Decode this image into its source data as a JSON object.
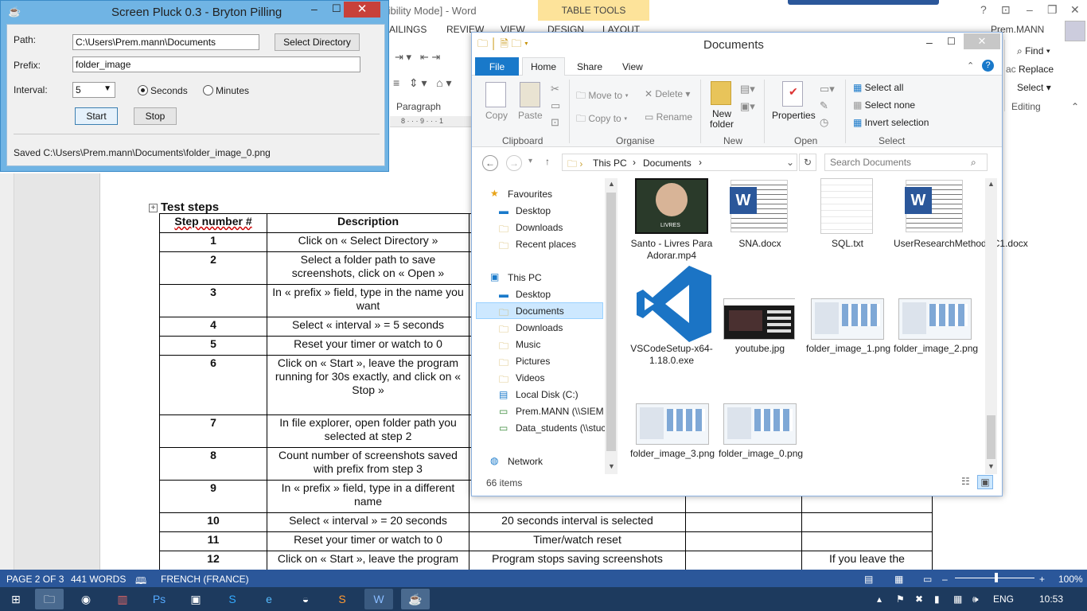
{
  "word": {
    "title": "tibility Mode] - Word",
    "table_tools": "TABLE TOOLS",
    "tabs": [
      "AILINGS",
      "REVIEW",
      "VIEW",
      "DESIGN",
      "LAYOUT"
    ],
    "user": "Prem.MANN",
    "paragraph_label": "Paragraph",
    "editing": {
      "find": "Find",
      "replace": "Replace",
      "select": "Select",
      "group": "Editing"
    },
    "heading": "Test steps",
    "table": {
      "headers": [
        "Step number #",
        "Description"
      ],
      "rows": [
        {
          "num": "1",
          "desc": "Click on « Select Directory »",
          "res": "",
          "c5": ""
        },
        {
          "num": "2",
          "desc": "Select a folder path to save screenshots, click on « Open »",
          "res": "",
          "c5": ""
        },
        {
          "num": "3",
          "desc": "In « prefix » field, type in the name you want",
          "res": "",
          "c5": ""
        },
        {
          "num": "4",
          "desc": "Select « interval » = 5 seconds",
          "res": "",
          "c5": ""
        },
        {
          "num": "5",
          "desc": "Reset your timer or watch to 0",
          "res": "",
          "c5": ""
        },
        {
          "num": "6",
          "desc": "Click on « Start », leave the program running for 30s exactly, and click on « Stop »",
          "res": "",
          "c5": ""
        },
        {
          "num": "7",
          "desc": "In file explorer, open folder path you selected at step 2",
          "res": "",
          "c5": ""
        },
        {
          "num": "8",
          "desc": "Count number of screenshots saved with prefix from step 3",
          "res": "",
          "c5": ""
        },
        {
          "num": "9",
          "desc": "In « prefix » field, type in a different name",
          "res": "",
          "c5": ""
        },
        {
          "num": "10",
          "desc": "Select « interval » = 20 seconds",
          "res": "20 seconds interval is selected",
          "c5": ""
        },
        {
          "num": "11",
          "desc": "Reset your timer or watch to 0",
          "res": "Timer/watch reset",
          "c5": ""
        },
        {
          "num": "12",
          "desc": "Click on « Start », leave the program",
          "res": "Program stops saving screenshots",
          "c5": "If you leave the"
        }
      ]
    },
    "status": {
      "page": "PAGE 2 OF 3",
      "words": "441 WORDS",
      "lang": "FRENCH (FRANCE)",
      "zoom": "100%"
    }
  },
  "screen_pluck": {
    "title": "Screen Pluck 0.3 - Bryton Pilling",
    "path_label": "Path:",
    "path_value": "C:\\Users\\Prem.mann\\Documents",
    "select_dir": "Select Directory",
    "prefix_label": "Prefix:",
    "prefix_value": "folder_image",
    "interval_label": "Interval:",
    "interval_value": "5",
    "seconds": "Seconds",
    "minutes": "Minutes",
    "start": "Start",
    "stop": "Stop",
    "saved": "Saved C:\\Users\\Prem.mann\\Documents\\folder_image_0.png"
  },
  "explorer": {
    "title": "Documents",
    "tabs": {
      "file": "File",
      "home": "Home",
      "share": "Share",
      "view": "View"
    },
    "ribbon": {
      "copy": "Copy",
      "paste": "Paste",
      "clipboard": "Clipboard",
      "move_to": "Move to",
      "copy_to": "Copy to",
      "delete": "Delete",
      "rename": "Rename",
      "organise": "Organise",
      "new_folder": "New folder",
      "new": "New",
      "properties": "Properties",
      "open": "Open",
      "select_all": "Select all",
      "select_none": "Select none",
      "invert_selection": "Invert selection",
      "select": "Select"
    },
    "address": [
      "This PC",
      "Documents"
    ],
    "search_placeholder": "Search Documents",
    "nav": {
      "favourites": "Favourites",
      "fav_items": [
        "Desktop",
        "Downloads",
        "Recent places"
      ],
      "this_pc": "This PC",
      "pc_items": [
        "Desktop",
        "Documents",
        "Downloads",
        "Music",
        "Pictures",
        "Videos",
        "Local Disk (C:)",
        "Prem.MANN (\\\\SIEM",
        "Data_students (\\\\stuc"
      ],
      "network": "Network"
    },
    "files": [
      {
        "name": "Santo - Livres Para Adorar.mp4",
        "thumb_text": "LIVRES"
      },
      {
        "name": "SNA.docx"
      },
      {
        "name": "SQL.txt"
      },
      {
        "name": "UserResearchMethodVC1.docx"
      },
      {
        "name": "VSCodeSetup-x64-1.18.0.exe"
      },
      {
        "name": "youtube.jpg"
      },
      {
        "name": "folder_image_1.png"
      },
      {
        "name": "folder_image_2.png"
      },
      {
        "name": "folder_image_3.png"
      },
      {
        "name": "folder_image_0.png"
      }
    ],
    "item_count": "66 items"
  },
  "taskbar": {
    "lang": "ENG",
    "time": "10:53"
  }
}
